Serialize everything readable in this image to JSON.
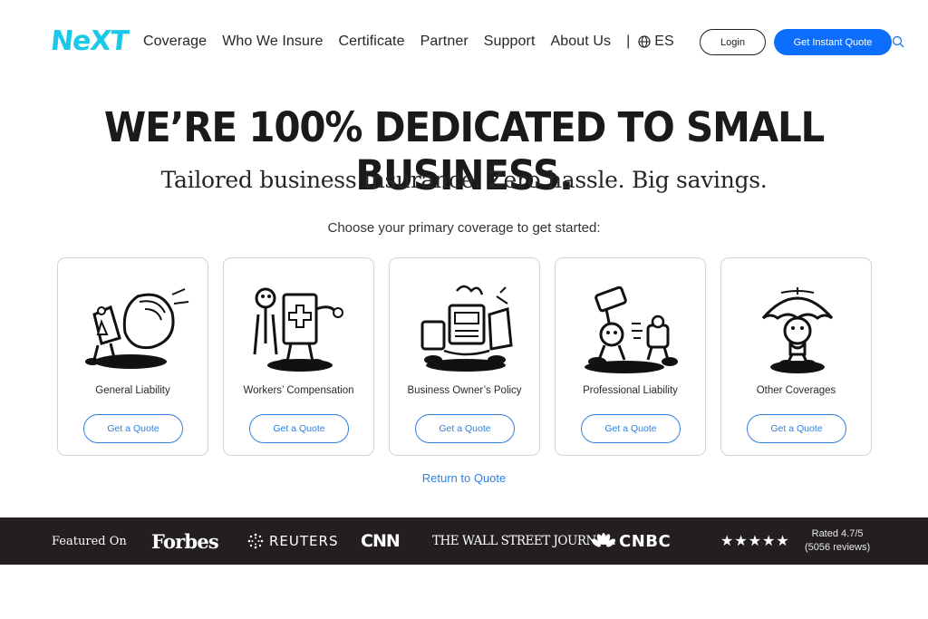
{
  "header": {
    "logo_text": "NeXT",
    "nav": [
      "Coverage",
      "Who We Insure",
      "Certificate",
      "Partner",
      "Support",
      "About Us"
    ],
    "separator": "|",
    "language": "ES",
    "login_label": "Login",
    "quote_label": "Get Instant Quote"
  },
  "hero": {
    "title": "WE’RE 100% DEDICATED TO SMALL BUSINESS.",
    "subtitle": "Tailored business insurance. Zero hassle. Big savings.",
    "prompt": "Choose your primary coverage to get started:"
  },
  "cards": [
    {
      "label": "General Liability",
      "button": "Get a Quote",
      "icon": "general-liability-illustration"
    },
    {
      "label": "Workers’ Compensation",
      "button": "Get a Quote",
      "icon": "workers-compensation-illustration"
    },
    {
      "label": "Business Owner’s Policy",
      "button": "Get a Quote",
      "icon": "business-owners-policy-illustration"
    },
    {
      "label": "Professional Liability",
      "button": "Get a Quote",
      "icon": "professional-liability-illustration"
    },
    {
      "label": "Other Coverages",
      "button": "Get a Quote",
      "icon": "other-coverages-illustration"
    }
  ],
  "return_link": "Return to Quote",
  "featured": {
    "label": "Featured On",
    "outlets": [
      "Forbes",
      "REUTERS",
      "CNN",
      "THE WALL STREET JOURNAL.",
      "CNBC"
    ],
    "stars": "★★★★★",
    "rating_line1": "Rated 4.7/5",
    "rating_line2": "(5056 reviews)"
  },
  "colors": {
    "logo": "#1cc8e8",
    "primary_button": "#0d6efd",
    "link": "#2f7fdf",
    "featured_bar": "#231f20"
  }
}
